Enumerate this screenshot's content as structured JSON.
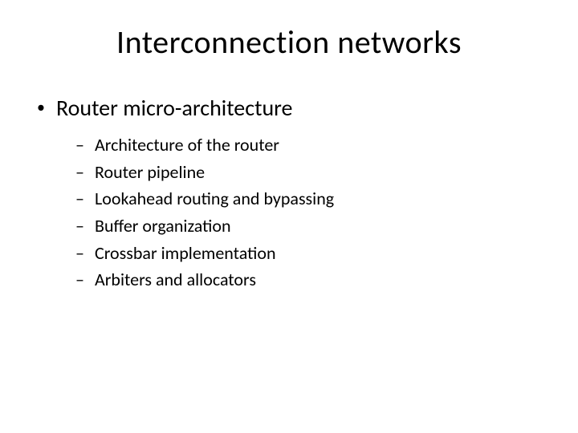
{
  "title": "Interconnection networks",
  "main_bullet": "Router micro-architecture",
  "sub_bullets": {
    "item0": "Architecture of the router",
    "item1": "Router pipeline",
    "item2": "Lookahead routing and bypassing",
    "item3": "Buffer organization",
    "item4": "Crossbar implementation",
    "item5": "Arbiters and allocators"
  }
}
